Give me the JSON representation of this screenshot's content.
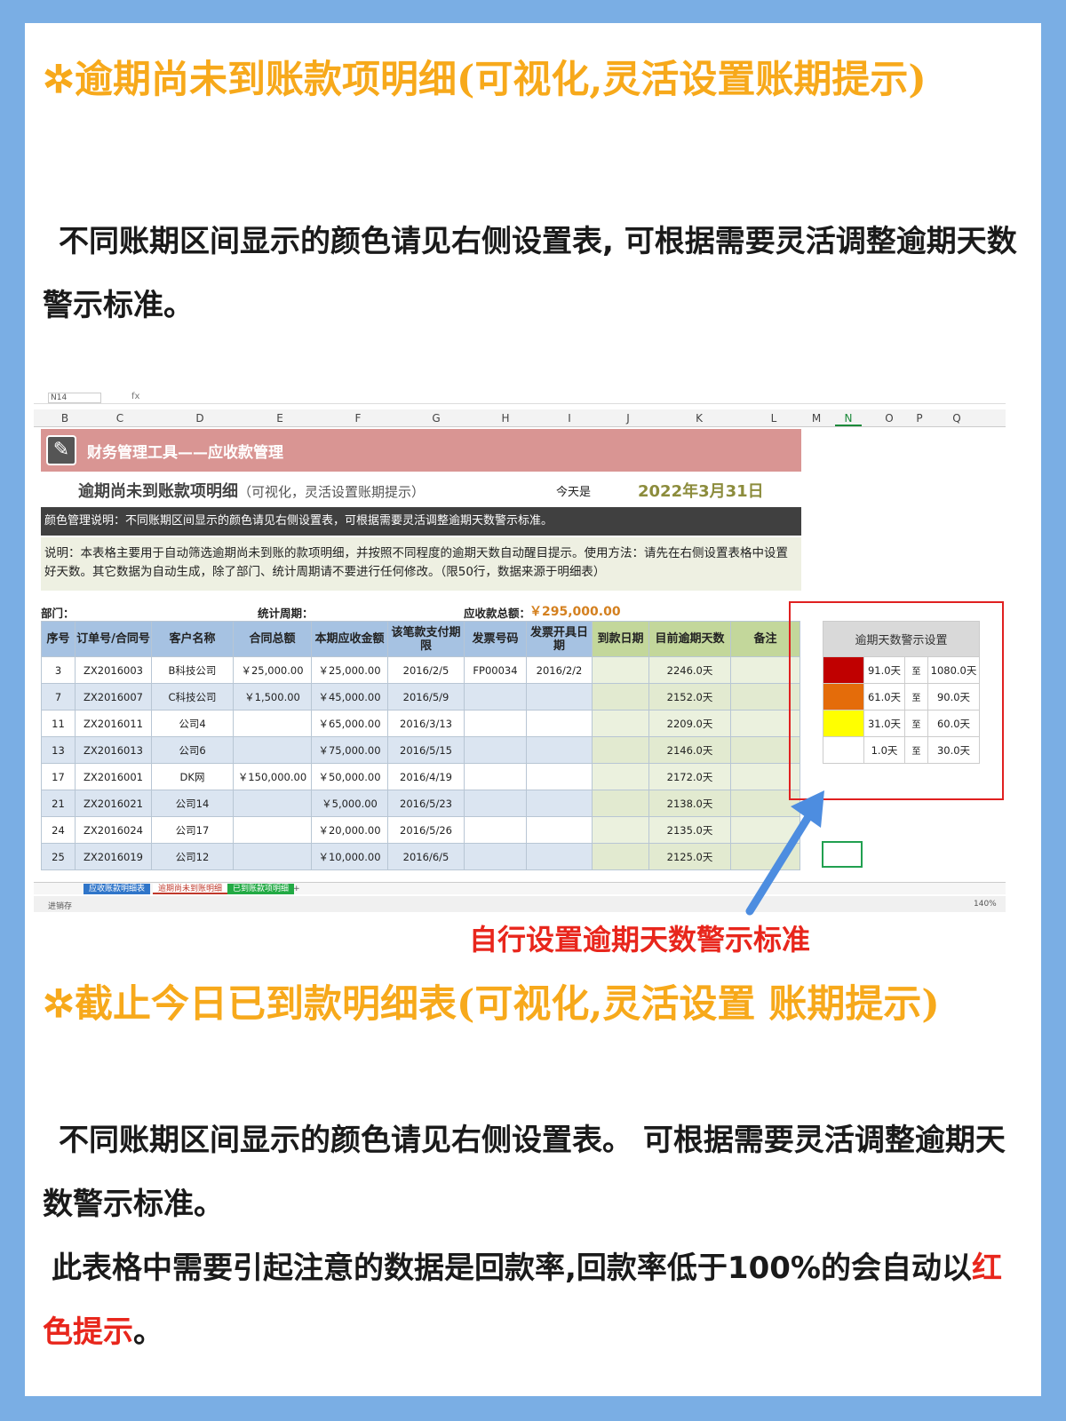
{
  "section1": {
    "star": "✲",
    "title": "逾期尚未到账款项明细(可视化,灵活设置账期提示)",
    "desc": "不同账期区间显示的颜色请见右侧设置表, 可根据需要灵活调整逾期天数警示标准。"
  },
  "screenshot": {
    "cell_ref": "N14",
    "fx": "fx",
    "columns": [
      "B",
      "C",
      "D",
      "E",
      "F",
      "G",
      "H",
      "I",
      "J",
      "K",
      "L",
      "M",
      "N",
      "O",
      "P",
      "Q"
    ],
    "selected_column": "N",
    "banner_title": "财务管理工具——应收款管理",
    "sheet_title": "逾期尚未到账款项明细",
    "sheet_subtitle": "（可视化，灵活设置账期提示）",
    "today_label": "今天是",
    "today_date": "2022年3月31日",
    "color_note": "颜色管理说明：不同账期区间显示的颜色请见右侧设置表，可根据需要灵活调整逾期天数警示标准。",
    "usage_note": "说明：本表格主要用于自动筛选逾期尚未到账的款项明细，并按照不同程度的逾期天数自动醒目提示。使用方法：请先在右侧设置表格中设置好天数。其它数据为自动生成，除了部门、统计周期请不要进行任何修改。（限50行，数据来源于明细表）",
    "dept_label": "部门：",
    "period_label": "统计周期：",
    "total_label": "应收款总额：",
    "total_value": "￥295,000.00",
    "headers": [
      "序号",
      "订单号/合同号",
      "客户名称",
      "合同总额",
      "本期应收金额",
      "该笔款支付期限",
      "发票号码",
      "发票开具日期",
      "到款日期",
      "目前逾期天数",
      "备注"
    ],
    "rows": [
      [
        "3",
        "ZX2016003",
        "B科技公司",
        "￥25,000.00",
        "￥25,000.00",
        "2016/2/5",
        "FP00034",
        "2016/2/2",
        "",
        "2246.0天",
        ""
      ],
      [
        "7",
        "ZX2016007",
        "C科技公司",
        "￥1,500.00",
        "￥45,000.00",
        "2016/5/9",
        "",
        "",
        "",
        "2152.0天",
        ""
      ],
      [
        "11",
        "ZX2016011",
        "公司4",
        "",
        "￥65,000.00",
        "2016/3/13",
        "",
        "",
        "",
        "2209.0天",
        ""
      ],
      [
        "13",
        "ZX2016013",
        "公司6",
        "",
        "￥75,000.00",
        "2016/5/15",
        "",
        "",
        "",
        "2146.0天",
        ""
      ],
      [
        "17",
        "ZX2016001",
        "DK网",
        "￥150,000.00",
        "￥50,000.00",
        "2016/4/19",
        "",
        "",
        "",
        "2172.0天",
        ""
      ],
      [
        "21",
        "ZX2016021",
        "公司14",
        "",
        "￥5,000.00",
        "2016/5/23",
        "",
        "",
        "",
        "2138.0天",
        ""
      ],
      [
        "24",
        "ZX2016024",
        "公司17",
        "",
        "￥20,000.00",
        "2016/5/26",
        "",
        "",
        "",
        "2135.0天",
        ""
      ],
      [
        "25",
        "ZX2016019",
        "公司12",
        "",
        "￥10,000.00",
        "2016/6/5",
        "",
        "",
        "",
        "2125.0天",
        ""
      ]
    ],
    "warning": {
      "title": "逾期天数警示设置",
      "rows": [
        {
          "color": "#c00000",
          "from": "91.0天",
          "to_label": "至",
          "to": "1080.0天"
        },
        {
          "color": "#e46c0a",
          "from": "61.0天",
          "to_label": "至",
          "to": "90.0天"
        },
        {
          "color": "#ffff00",
          "from": "31.0天",
          "to_label": "至",
          "to": "60.0天"
        },
        {
          "color": "#ffffff",
          "from": "1.0天",
          "to_label": "至",
          "to": "30.0天"
        }
      ]
    },
    "tabs": [
      "应收账款明细表",
      "逾期尚未到账明细",
      "已到账款项明细"
    ],
    "tab_plus": "+",
    "status_left": "进销存",
    "zoom": "140%"
  },
  "caption": "自行设置逾期天数警示标准",
  "section2": {
    "star": "✲",
    "title": "截止今日已到款明细表(可视化,灵活设置 账期提示)",
    "desc1": "不同账期区间显示的颜色请见右侧设置表。 可根据需要灵活调整逾期天数警示标准。",
    "desc2a": "此表格中需要引起注意的数据是回款率,回款率低于100%的会自动以",
    "desc2b": "红色提示",
    "desc2c": "。"
  },
  "colors": {
    "background": "#7aaee4",
    "heading": "#f7a91b",
    "accent_red": "#e8261c"
  }
}
